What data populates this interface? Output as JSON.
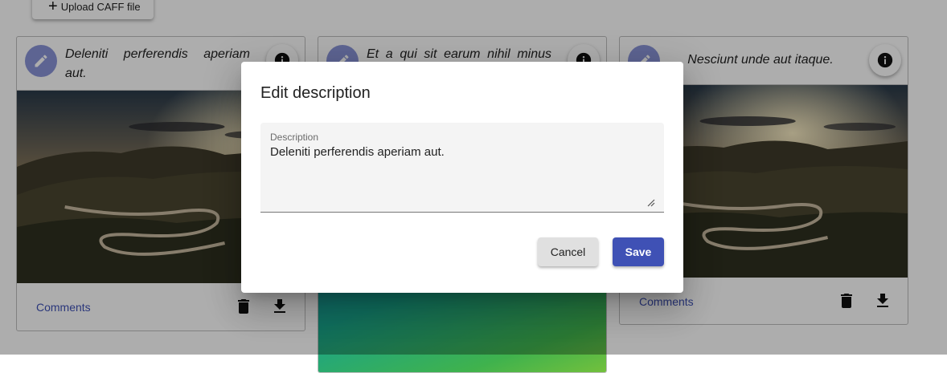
{
  "toolbar": {
    "upload_label": "Upload CAFF file"
  },
  "cards": [
    {
      "description": "Deleniti perferendis aperiam aut.",
      "comments_label": "Comments"
    },
    {
      "description": "Et a qui sit earum nihil minus"
    },
    {
      "description": "Nesciunt unde aut itaque.",
      "comments_label": "Comments"
    }
  ],
  "dialog": {
    "title": "Edit description",
    "field_label": "Description",
    "field_value": "Deleniti perferendis aperiam aut.",
    "cancel_label": "Cancel",
    "save_label": "Save"
  },
  "icons": {
    "edit": "pencil-icon",
    "info": "info-icon",
    "trash": "trash-icon",
    "download": "download-icon",
    "plus": "plus-icon"
  },
  "colors": {
    "primary": "#3f51b5",
    "edit_fab": "#8a94d8",
    "cancel_bg": "#e0e0e0",
    "field_bg": "#f4f4f4"
  }
}
